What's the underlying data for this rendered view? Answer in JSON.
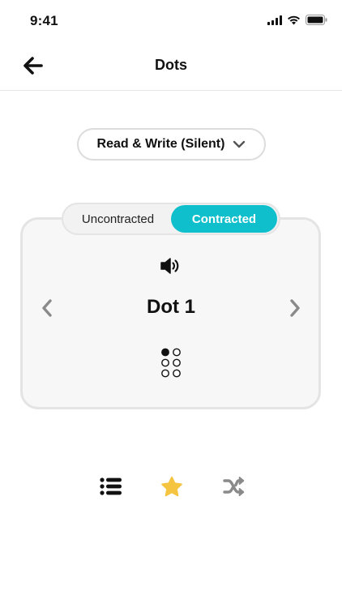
{
  "status_bar": {
    "time": "9:41"
  },
  "nav": {
    "title": "Dots"
  },
  "mode": {
    "selected": "Read & Write (Silent)"
  },
  "segments": {
    "uncontracted": "Uncontracted",
    "contracted": "Contracted",
    "active": "contracted"
  },
  "card": {
    "title": "Dot 1",
    "braille_cell": [
      1,
      0,
      0,
      0,
      0,
      0
    ]
  },
  "icons": {
    "back": "arrow-left-icon",
    "speaker": "speaker-icon",
    "prev": "chevron-left-icon",
    "next": "chevron-right-icon",
    "list": "list-icon",
    "star": "star-icon",
    "shuffle": "shuffle-icon"
  },
  "colors": {
    "accent": "#10bfcc",
    "star": "#f5c542",
    "muted": "#8a8a8a"
  }
}
